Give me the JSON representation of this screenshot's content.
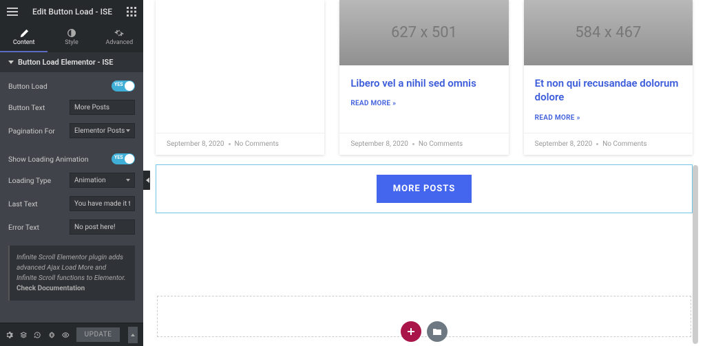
{
  "header": {
    "title": "Edit Button Load - ISE"
  },
  "tabs": {
    "content": "Content",
    "style": "Style",
    "advanced": "Advanced"
  },
  "section": {
    "title": "Button Load Elementor - ISE"
  },
  "controls": {
    "buttonLoad": {
      "label": "Button Load",
      "toggle": "YES"
    },
    "buttonText": {
      "label": "Button Text",
      "value": "More Posts"
    },
    "paginationFor": {
      "label": "Pagination For",
      "value": "Elementor Posts"
    },
    "showLoading": {
      "label": "Show Loading Animation",
      "toggle": "YES"
    },
    "loadingType": {
      "label": "Loading Type",
      "value": "Animation"
    },
    "lastText": {
      "label": "Last Text",
      "value": "You have made it till the end!"
    },
    "errorText": {
      "label": "Error Text",
      "value": "No post here!"
    }
  },
  "info": {
    "text": "Infinite Scroll Elementor plugin adds advanced Ajax Load More and Infinite Scroll functions to Elementor.",
    "link": "Check Documentation"
  },
  "footer": {
    "update": "UPDATE"
  },
  "preview": {
    "cards": [
      {
        "imgText": "",
        "title": "",
        "readMore": "",
        "date": "September 8, 2020",
        "comments": "No Comments"
      },
      {
        "imgText": "627 x 501",
        "title": "Libero vel a nihil sed omnis",
        "readMore": "READ MORE »",
        "date": "September 8, 2020",
        "comments": "No Comments"
      },
      {
        "imgText": "584 x 467",
        "title": "Et non qui recusandae dolorum dolore",
        "readMore": "READ MORE »",
        "date": "September 8, 2020",
        "comments": "No Comments"
      }
    ],
    "moreBtn": "MORE POSTS"
  }
}
